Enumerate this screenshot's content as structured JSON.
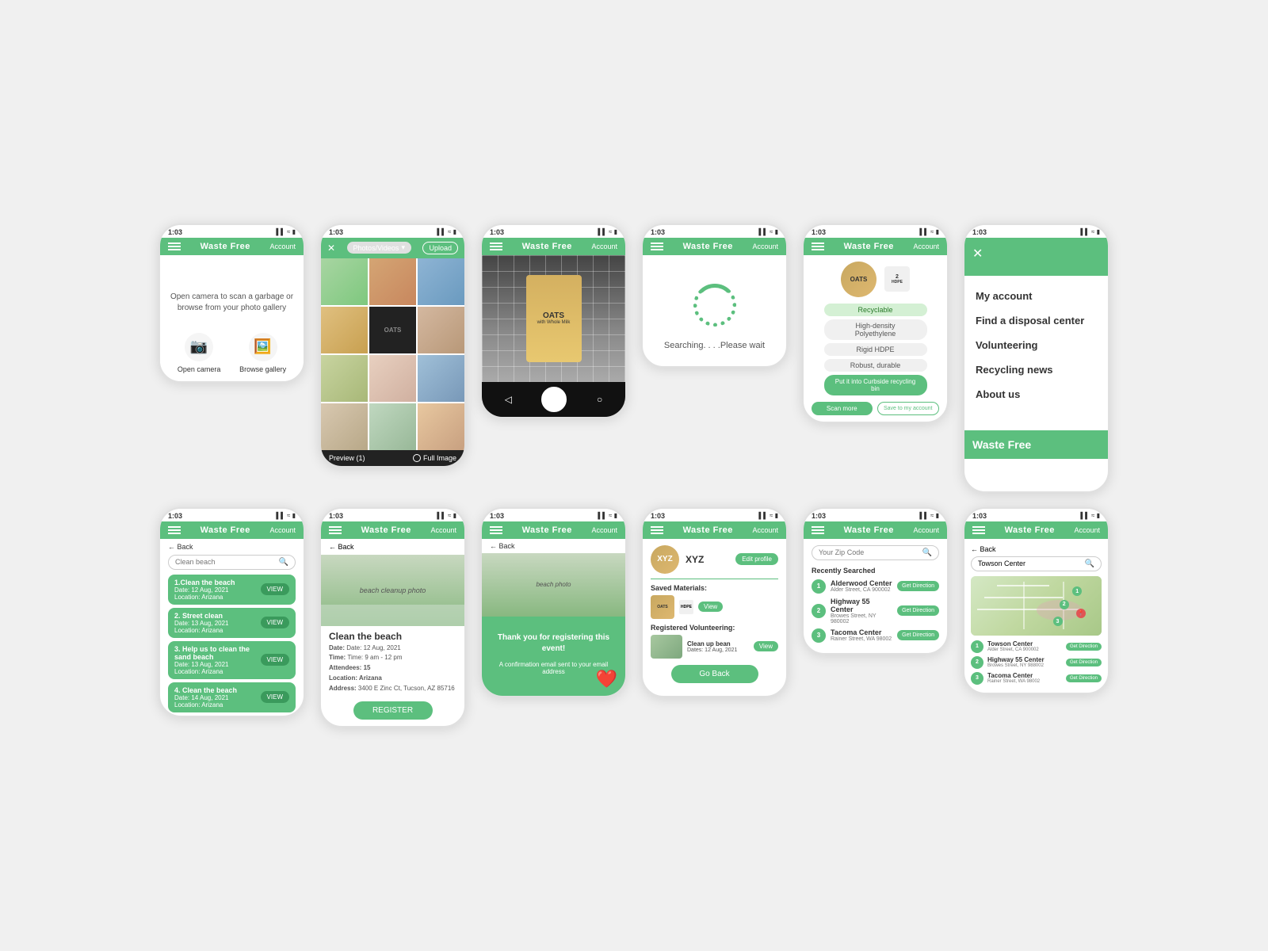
{
  "app": {
    "name": "Waste Free",
    "account_label": "Account",
    "time": "1:03",
    "back_label": "← Back"
  },
  "screen1": {
    "desc": "Open camera to scan a garbage or browse from your photo gallery",
    "camera_label": "Open camera",
    "gallery_label": "Browse gallery"
  },
  "screen2": {
    "photos_label": "Photos/Videos",
    "upload_label": "Upload",
    "preview_label": "Preview (1)",
    "full_image_label": "Full Image"
  },
  "screen3": {
    "product_label": "OATS"
  },
  "screen4": {
    "searching_text": "Searching. . . .Please wait"
  },
  "screen5": {
    "recyclable": "Recyclable",
    "tag1": "High-density Polyethylene",
    "tag2": "Rigid HDPE",
    "tag3": "Robust, durable",
    "action": "Put it into Curbside recycling bin",
    "btn_scan": "Scan more",
    "btn_save": "Save to my account"
  },
  "screen6": {
    "search_placeholder": "Clean beach",
    "items": [
      {
        "num": "1.",
        "name": "1.Clean the beach",
        "date": "Date: 12 Aug, 2021",
        "location": "Location: Arizana"
      },
      {
        "num": "2.",
        "name": "2. Street clean",
        "date": "Date: 13 Aug, 2021",
        "location": "Location: Arizana"
      },
      {
        "num": "3.",
        "name": "3. Help us to clean the sand beach",
        "date": "Date: 13 Aug, 2021",
        "location": "Location: Arizana"
      },
      {
        "num": "4.",
        "name": "4. Clean the beach",
        "date": "Date: 14 Aug, 2021",
        "location": "Location: Arizana"
      }
    ],
    "view_label": "VIEW"
  },
  "screen7": {
    "event_name": "Clean the beach",
    "date": "Date: 12 Aug, 2021",
    "time": "Time: 9 am - 12 pm",
    "attendees": "Attendees: 15",
    "location": "Location: Arizana",
    "address": "Address: 3400 E Zinc Ct, Tucson, AZ 85716",
    "register_label": "REGISTER"
  },
  "screen8": {
    "confirm_text": "Thank you for registering this event!",
    "confirm_sub": "A confirmation email sent to your email address",
    "heart": "❤️"
  },
  "screen9": {
    "username": "XYZ",
    "edit_label": "Edit profile",
    "saved_materials": "Saved Materials:",
    "view_label": "View",
    "registered_vol": "Registered Volunteering:",
    "vol_name": "Clean up bean",
    "vol_date": "Dates: 12 Aug, 2021",
    "goback_label": "Go Back"
  },
  "screen10": {
    "zip_placeholder": "Your Zip Code",
    "recently_searched": "Recently Searched",
    "centers": [
      {
        "num": "1",
        "name": "Alderwood Center",
        "addr": "Alder Street, CA 900002"
      },
      {
        "num": "2",
        "name": "Highway 55 Center",
        "addr": "Browes Street, NY 980002"
      },
      {
        "num": "3",
        "name": "Tacoma Center",
        "addr": "Rainer Street, WA 98002"
      }
    ],
    "direction_label": "Get Direction"
  },
  "screen11": {
    "menu_items": [
      "My account",
      "Find a disposal center",
      "Volunteering",
      "Recycling news",
      "About us"
    ],
    "footer_title": "Waste Free"
  },
  "screen12": {
    "search_value": "Towson Center",
    "centers": [
      {
        "num": "1",
        "name": "Towson Center",
        "addr": "Alder Street, CA 900002"
      },
      {
        "num": "2",
        "name": "Highway 55 Center",
        "addr": "Browes Street, NY 988002"
      },
      {
        "num": "3",
        "name": "Tacoma Center",
        "addr": "Rainer Street, WA 98002"
      }
    ],
    "direction_label": "Get Direction"
  }
}
